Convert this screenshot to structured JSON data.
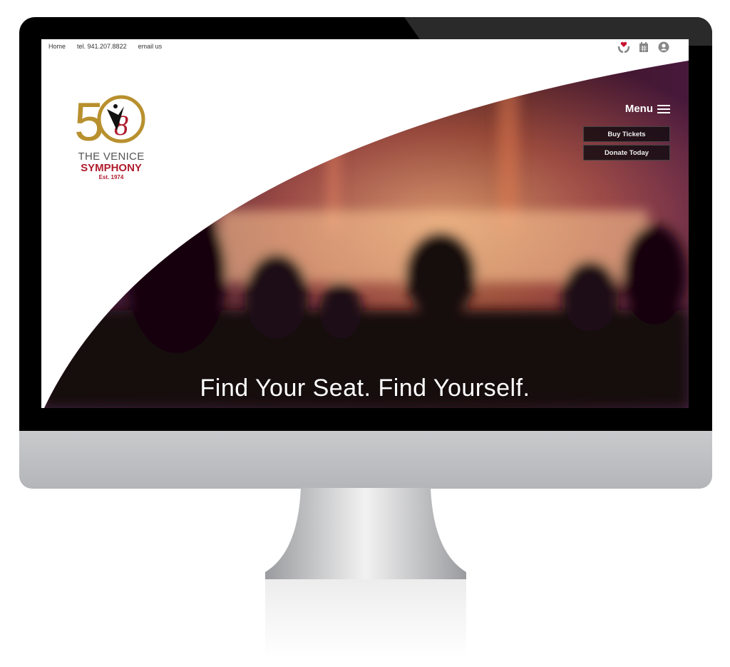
{
  "topbar": {
    "links": [
      "Home",
      "tel. 941.207.8822",
      "email us"
    ]
  },
  "icons": [
    "donate-hands-heart-icon",
    "calendar-icon",
    "account-icon"
  ],
  "logo": {
    "number": "50",
    "line1": "THE VENICE",
    "line2": "SYMPHONY",
    "line3": "Est. 1974"
  },
  "header": {
    "menu_label": "Menu",
    "buy_tickets": "Buy Tickets",
    "donate_today": "Donate Today"
  },
  "hero": {
    "tagline": "Find Your Seat. Find Yourself."
  },
  "colors": {
    "brand_gold": "#b8902e",
    "brand_red": "#b01c2e"
  }
}
